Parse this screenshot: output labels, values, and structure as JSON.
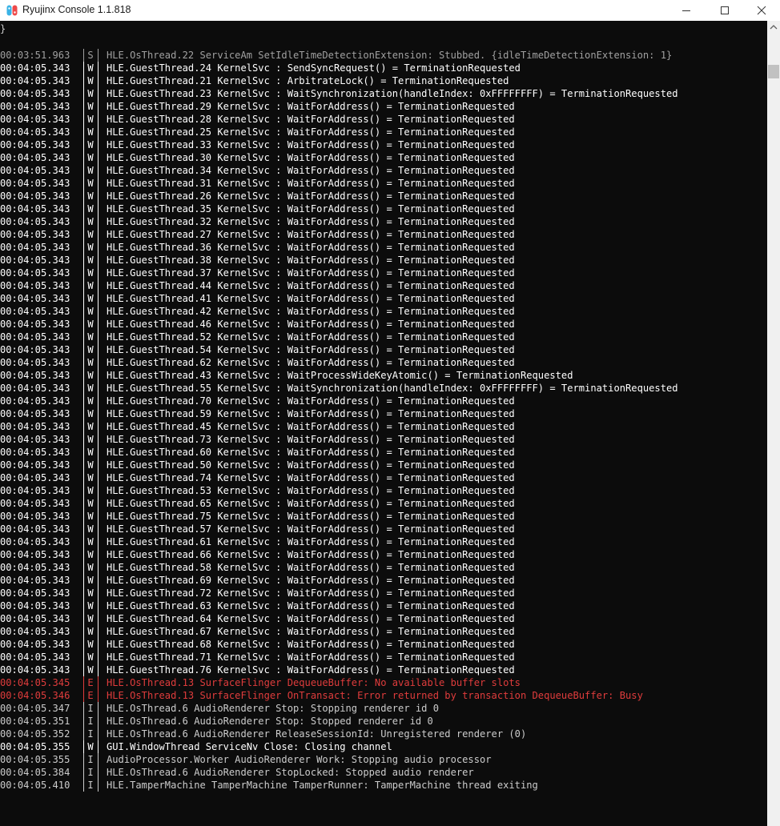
{
  "window": {
    "title": "Ryujinx Console 1.1.818",
    "icon": "ryujinx-app-icon",
    "controls": [
      "minimize-icon",
      "maximize-icon",
      "close-icon"
    ]
  },
  "console": {
    "caret": "}",
    "colors": {
      "S": "#a0a0a0",
      "W": "#ffffff",
      "E": "#e03c3c",
      "I": "#cccccc",
      "background": "#0c0c0c"
    },
    "lines": [
      {
        "time": "00:03:51.963",
        "level": "S",
        "msg": "HLE.OsThread.22 ServiceAm SetIdleTimeDetectionExtension: Stubbed. {idleTimeDetectionExtension: 1}"
      },
      {
        "time": "00:04:05.343",
        "level": "W",
        "msg": "HLE.GuestThread.24 KernelSvc : SendSyncRequest() = TerminationRequested"
      },
      {
        "time": "00:04:05.343",
        "level": "W",
        "msg": "HLE.GuestThread.21 KernelSvc : ArbitrateLock() = TerminationRequested"
      },
      {
        "time": "00:04:05.343",
        "level": "W",
        "msg": "HLE.GuestThread.23 KernelSvc : WaitSynchronization(handleIndex: 0xFFFFFFFF) = TerminationRequested"
      },
      {
        "time": "00:04:05.343",
        "level": "W",
        "msg": "HLE.GuestThread.29 KernelSvc : WaitForAddress() = TerminationRequested"
      },
      {
        "time": "00:04:05.343",
        "level": "W",
        "msg": "HLE.GuestThread.28 KernelSvc : WaitForAddress() = TerminationRequested"
      },
      {
        "time": "00:04:05.343",
        "level": "W",
        "msg": "HLE.GuestThread.25 KernelSvc : WaitForAddress() = TerminationRequested"
      },
      {
        "time": "00:04:05.343",
        "level": "W",
        "msg": "HLE.GuestThread.33 KernelSvc : WaitForAddress() = TerminationRequested"
      },
      {
        "time": "00:04:05.343",
        "level": "W",
        "msg": "HLE.GuestThread.30 KernelSvc : WaitForAddress() = TerminationRequested"
      },
      {
        "time": "00:04:05.343",
        "level": "W",
        "msg": "HLE.GuestThread.34 KernelSvc : WaitForAddress() = TerminationRequested"
      },
      {
        "time": "00:04:05.343",
        "level": "W",
        "msg": "HLE.GuestThread.31 KernelSvc : WaitForAddress() = TerminationRequested"
      },
      {
        "time": "00:04:05.343",
        "level": "W",
        "msg": "HLE.GuestThread.26 KernelSvc : WaitForAddress() = TerminationRequested"
      },
      {
        "time": "00:04:05.343",
        "level": "W",
        "msg": "HLE.GuestThread.35 KernelSvc : WaitForAddress() = TerminationRequested"
      },
      {
        "time": "00:04:05.343",
        "level": "W",
        "msg": "HLE.GuestThread.32 KernelSvc : WaitForAddress() = TerminationRequested"
      },
      {
        "time": "00:04:05.343",
        "level": "W",
        "msg": "HLE.GuestThread.27 KernelSvc : WaitForAddress() = TerminationRequested"
      },
      {
        "time": "00:04:05.343",
        "level": "W",
        "msg": "HLE.GuestThread.36 KernelSvc : WaitForAddress() = TerminationRequested"
      },
      {
        "time": "00:04:05.343",
        "level": "W",
        "msg": "HLE.GuestThread.38 KernelSvc : WaitForAddress() = TerminationRequested"
      },
      {
        "time": "00:04:05.343",
        "level": "W",
        "msg": "HLE.GuestThread.37 KernelSvc : WaitForAddress() = TerminationRequested"
      },
      {
        "time": "00:04:05.343",
        "level": "W",
        "msg": "HLE.GuestThread.44 KernelSvc : WaitForAddress() = TerminationRequested"
      },
      {
        "time": "00:04:05.343",
        "level": "W",
        "msg": "HLE.GuestThread.41 KernelSvc : WaitForAddress() = TerminationRequested"
      },
      {
        "time": "00:04:05.343",
        "level": "W",
        "msg": "HLE.GuestThread.42 KernelSvc : WaitForAddress() = TerminationRequested"
      },
      {
        "time": "00:04:05.343",
        "level": "W",
        "msg": "HLE.GuestThread.46 KernelSvc : WaitForAddress() = TerminationRequested"
      },
      {
        "time": "00:04:05.343",
        "level": "W",
        "msg": "HLE.GuestThread.52 KernelSvc : WaitForAddress() = TerminationRequested"
      },
      {
        "time": "00:04:05.343",
        "level": "W",
        "msg": "HLE.GuestThread.54 KernelSvc : WaitForAddress() = TerminationRequested"
      },
      {
        "time": "00:04:05.343",
        "level": "W",
        "msg": "HLE.GuestThread.62 KernelSvc : WaitForAddress() = TerminationRequested"
      },
      {
        "time": "00:04:05.343",
        "level": "W",
        "msg": "HLE.GuestThread.43 KernelSvc : WaitProcessWideKeyAtomic() = TerminationRequested"
      },
      {
        "time": "00:04:05.343",
        "level": "W",
        "msg": "HLE.GuestThread.55 KernelSvc : WaitSynchronization(handleIndex: 0xFFFFFFFF) = TerminationRequested"
      },
      {
        "time": "00:04:05.343",
        "level": "W",
        "msg": "HLE.GuestThread.70 KernelSvc : WaitForAddress() = TerminationRequested"
      },
      {
        "time": "00:04:05.343",
        "level": "W",
        "msg": "HLE.GuestThread.59 KernelSvc : WaitForAddress() = TerminationRequested"
      },
      {
        "time": "00:04:05.343",
        "level": "W",
        "msg": "HLE.GuestThread.45 KernelSvc : WaitForAddress() = TerminationRequested"
      },
      {
        "time": "00:04:05.343",
        "level": "W",
        "msg": "HLE.GuestThread.73 KernelSvc : WaitForAddress() = TerminationRequested"
      },
      {
        "time": "00:04:05.343",
        "level": "W",
        "msg": "HLE.GuestThread.60 KernelSvc : WaitForAddress() = TerminationRequested"
      },
      {
        "time": "00:04:05.343",
        "level": "W",
        "msg": "HLE.GuestThread.50 KernelSvc : WaitForAddress() = TerminationRequested"
      },
      {
        "time": "00:04:05.343",
        "level": "W",
        "msg": "HLE.GuestThread.74 KernelSvc : WaitForAddress() = TerminationRequested"
      },
      {
        "time": "00:04:05.343",
        "level": "W",
        "msg": "HLE.GuestThread.53 KernelSvc : WaitForAddress() = TerminationRequested"
      },
      {
        "time": "00:04:05.343",
        "level": "W",
        "msg": "HLE.GuestThread.65 KernelSvc : WaitForAddress() = TerminationRequested"
      },
      {
        "time": "00:04:05.343",
        "level": "W",
        "msg": "HLE.GuestThread.75 KernelSvc : WaitForAddress() = TerminationRequested"
      },
      {
        "time": "00:04:05.343",
        "level": "W",
        "msg": "HLE.GuestThread.57 KernelSvc : WaitForAddress() = TerminationRequested"
      },
      {
        "time": "00:04:05.343",
        "level": "W",
        "msg": "HLE.GuestThread.61 KernelSvc : WaitForAddress() = TerminationRequested"
      },
      {
        "time": "00:04:05.343",
        "level": "W",
        "msg": "HLE.GuestThread.66 KernelSvc : WaitForAddress() = TerminationRequested"
      },
      {
        "time": "00:04:05.343",
        "level": "W",
        "msg": "HLE.GuestThread.58 KernelSvc : WaitForAddress() = TerminationRequested"
      },
      {
        "time": "00:04:05.343",
        "level": "W",
        "msg": "HLE.GuestThread.69 KernelSvc : WaitForAddress() = TerminationRequested"
      },
      {
        "time": "00:04:05.343",
        "level": "W",
        "msg": "HLE.GuestThread.72 KernelSvc : WaitForAddress() = TerminationRequested"
      },
      {
        "time": "00:04:05.343",
        "level": "W",
        "msg": "HLE.GuestThread.63 KernelSvc : WaitForAddress() = TerminationRequested"
      },
      {
        "time": "00:04:05.343",
        "level": "W",
        "msg": "HLE.GuestThread.64 KernelSvc : WaitForAddress() = TerminationRequested"
      },
      {
        "time": "00:04:05.343",
        "level": "W",
        "msg": "HLE.GuestThread.67 KernelSvc : WaitForAddress() = TerminationRequested"
      },
      {
        "time": "00:04:05.343",
        "level": "W",
        "msg": "HLE.GuestThread.68 KernelSvc : WaitForAddress() = TerminationRequested"
      },
      {
        "time": "00:04:05.343",
        "level": "W",
        "msg": "HLE.GuestThread.71 KernelSvc : WaitForAddress() = TerminationRequested"
      },
      {
        "time": "00:04:05.343",
        "level": "W",
        "msg": "HLE.GuestThread.76 KernelSvc : WaitForAddress() = TerminationRequested"
      },
      {
        "time": "00:04:05.345",
        "level": "E",
        "msg": "HLE.OsThread.13 SurfaceFlinger DequeueBuffer: No available buffer slots"
      },
      {
        "time": "00:04:05.346",
        "level": "E",
        "msg": "HLE.OsThread.13 SurfaceFlinger OnTransact: Error returned by transaction DequeueBuffer: Busy"
      },
      {
        "time": "00:04:05.347",
        "level": "I",
        "msg": "HLE.OsThread.6 AudioRenderer Stop: Stopping renderer id 0"
      },
      {
        "time": "00:04:05.351",
        "level": "I",
        "msg": "HLE.OsThread.6 AudioRenderer Stop: Stopped renderer id 0"
      },
      {
        "time": "00:04:05.352",
        "level": "I",
        "msg": "HLE.OsThread.6 AudioRenderer ReleaseSessionId: Unregistered renderer (0)"
      },
      {
        "time": "00:04:05.355",
        "level": "W",
        "msg": "GUI.WindowThread ServiceNv Close: Closing channel"
      },
      {
        "time": "00:04:05.355",
        "level": "I",
        "msg": "AudioProcessor.Worker AudioRenderer Work: Stopping audio processor"
      },
      {
        "time": "00:04:05.384",
        "level": "I",
        "msg": "HLE.OsThread.6 AudioRenderer StopLocked: Stopped audio renderer"
      },
      {
        "time": "00:04:05.410",
        "level": "I",
        "msg": "HLE.TamperMachine TamperMachine TamperRunner: TamperMachine thread exiting"
      }
    ]
  }
}
